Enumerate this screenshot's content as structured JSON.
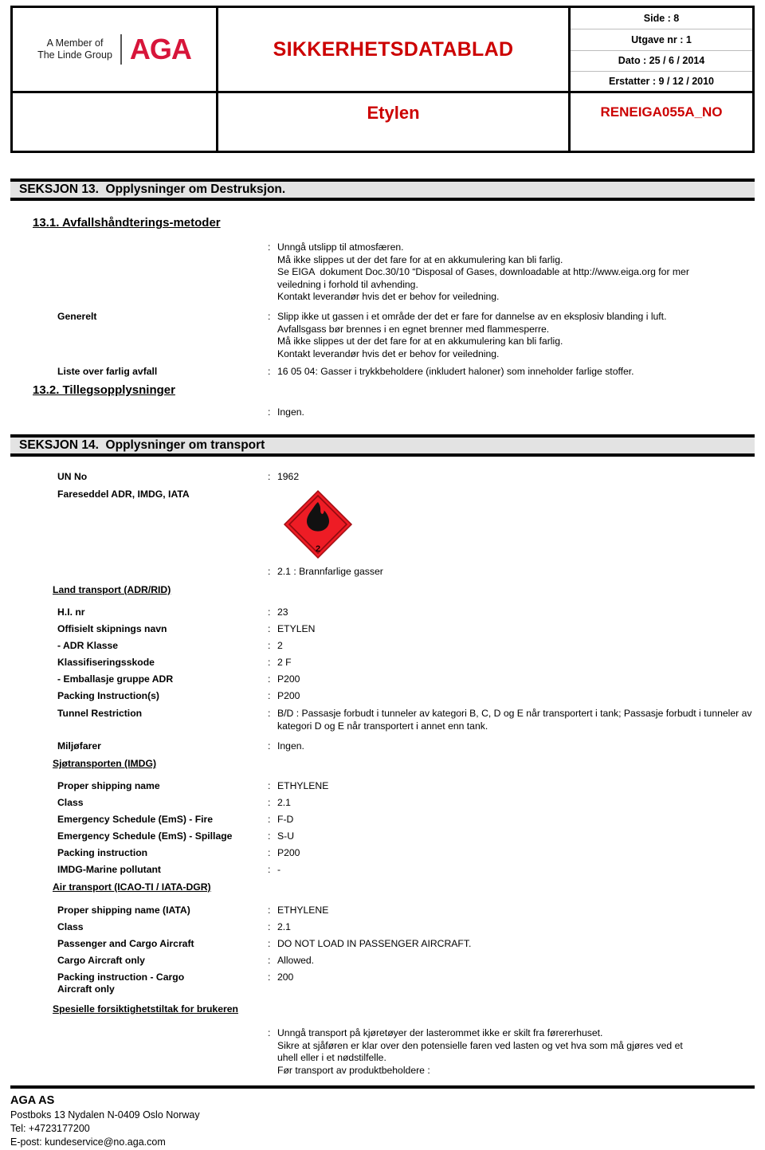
{
  "header": {
    "logo": {
      "line1": "A Member of",
      "line2": "The Linde Group",
      "brand": "AGA"
    },
    "title": "SIKKERHETSDATABLAD",
    "product_name": "Etylen",
    "meta": [
      "Side : 8",
      "Utgave nr : 1",
      "Dato : 25 / 6 / 2014",
      "Erstatter : 9 / 12 / 2010"
    ],
    "reference": "RENEIGA055A_NO"
  },
  "section13": {
    "bar": "SEKSJON 13.  Opplysninger om Destruksjon.",
    "sub_13_1": "13.1.  Avfallshåndterings-metoder",
    "sub_13_2": "13.2.  Tillegsopplysninger",
    "intro_value": "Unngå utslipp til atmosfæren.\nMå ikke slippes ut der det fare for at en akkumulering kan bli farlig.\nSe EIGA  dokument Doc.30/10 “Disposal of Gases, downloadable at http://www.eiga.org for mer\nveiledning i forhold til avhending.\nKontakt leverandør hvis det er behov for veiledning.",
    "generelt_label": "Generelt",
    "generelt_value": "Slipp ikke ut gassen i et område der det er fare for dannelse av en eksplosiv blanding i luft.\nAvfallsgass bør brennes i en egnet brenner med flammesperre.\nMå ikke slippes ut der det fare for at en akkumulering kan bli farlig.\nKontakt leverandør hvis det er behov for veiledning.",
    "waste_list_label": "Liste over farlig avfall",
    "waste_list_value": "16 05 04: Gasser i trykkbeholdere (inkludert haloner) som inneholder farlige stoffer.",
    "additional_value": "Ingen.",
    "colon": ":"
  },
  "section14": {
    "bar": "SEKSJON 14.  Opplysninger om transport",
    "un_no_label": "UN No",
    "un_no_value": "1962",
    "label_label": "Fareseddel ADR, IMDG, IATA",
    "hazard_diamond": {
      "class_number": "2",
      "color": "#ee1c25",
      "icon": "flame-icon"
    },
    "hazard_class_value": "2.1 : Brannfarlige gasser",
    "land": {
      "heading": "Land transport (ADR/RID)",
      "rows": [
        {
          "label": "H.I. nr",
          "value": "23"
        },
        {
          "label": "Offisielt skipnings navn",
          "value": "ETYLEN"
        },
        {
          "label": "- ADR Klasse",
          "value": "2"
        },
        {
          "label": "Klassifiseringsskode",
          "value": "2 F"
        },
        {
          "label": "- Emballasje gruppe ADR",
          "value": "P200"
        },
        {
          "label": "Packing Instruction(s)",
          "value": "P200"
        }
      ],
      "tunnel_label": "Tunnel Restriction",
      "tunnel_value": "B/D : Passasje forbudt i tunneler av kategori B, C, D og E når transportert i tank; Passasje forbudt i tunneler av kategori  D og E når transportert i annet enn tank.",
      "env_label": "Miljøfarer",
      "env_value": "Ingen."
    },
    "sea": {
      "heading": "Sjøtransporten (IMDG)",
      "rows": [
        {
          "label": "Proper shipping name",
          "value": "ETHYLENE"
        },
        {
          "label": "Class",
          "value": "2.1"
        },
        {
          "label": "Emergency Schedule (EmS) - Fire",
          "value": "F-D"
        },
        {
          "label": "Emergency Schedule (EmS) - Spillage",
          "value": "S-U"
        },
        {
          "label": "Packing instruction",
          "value": "P200"
        },
        {
          "label": "IMDG-Marine pollutant",
          "value": "-"
        }
      ]
    },
    "air": {
      "heading": "Air transport (ICAO-TI / IATA-DGR)",
      "rows": [
        {
          "label": "Proper shipping name (IATA)",
          "value": "ETHYLENE"
        },
        {
          "label": "Class",
          "value": "2.1"
        },
        {
          "label": "Passenger and Cargo Aircraft",
          "value": "DO NOT LOAD IN PASSENGER AIRCRAFT."
        },
        {
          "label": "Cargo Aircraft only",
          "value": "Allowed."
        }
      ],
      "packing_label": "Packing instruction - Cargo Aircraft only",
      "packing_value": "200"
    },
    "precautions": {
      "heading": "Spesielle forsiktighetstiltak for brukeren",
      "value": "Unngå transport på kjøretøyer der lasterommet ikke er skilt fra førererhuset.\nSikre at sjåføren er klar over den potensielle faren ved lasten og vet hva som må gjøres ved et\nuhell eller i et nødstilfelle.\nFør transport av produktbeholdere :"
    }
  },
  "footer": {
    "company": "AGA AS",
    "address": "Postboks 13  Nydalen  N-0409  Oslo  Norway",
    "tel": "Tel: +4723177200",
    "email": "E-post: kundeservice@no.aga.com"
  }
}
